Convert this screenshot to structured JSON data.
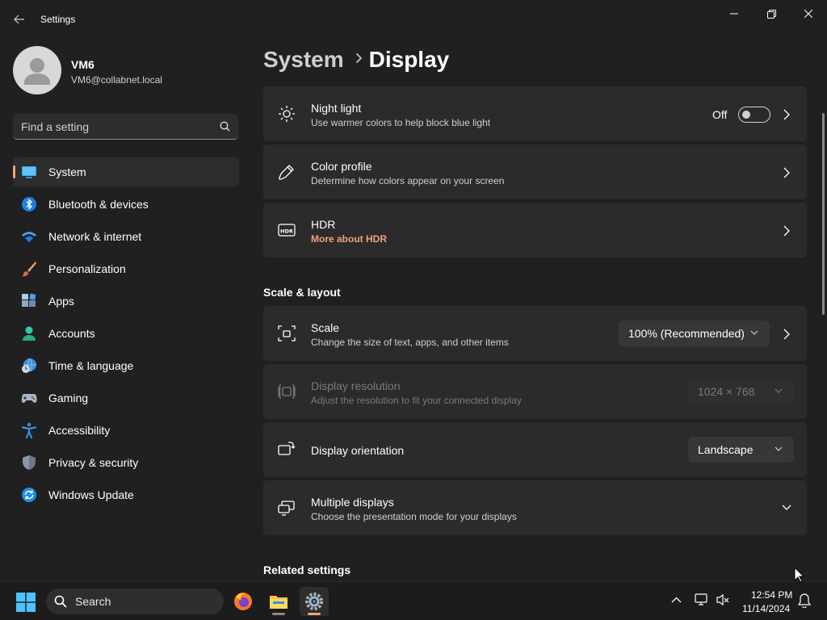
{
  "window": {
    "title": "Settings"
  },
  "user": {
    "name": "VM6",
    "email": "VM6@collabnet.local"
  },
  "search": {
    "placeholder": "Find a setting"
  },
  "sidebar": {
    "items": [
      {
        "label": "System",
        "icon": "system-icon",
        "active": true
      },
      {
        "label": "Bluetooth & devices",
        "icon": "bluetooth-icon"
      },
      {
        "label": "Network & internet",
        "icon": "network-icon"
      },
      {
        "label": "Personalization",
        "icon": "brush-icon"
      },
      {
        "label": "Apps",
        "icon": "apps-icon"
      },
      {
        "label": "Accounts",
        "icon": "accounts-icon"
      },
      {
        "label": "Time & language",
        "icon": "clock-globe-icon"
      },
      {
        "label": "Gaming",
        "icon": "gamepad-icon"
      },
      {
        "label": "Accessibility",
        "icon": "accessibility-icon"
      },
      {
        "label": "Privacy & security",
        "icon": "shield-icon"
      },
      {
        "label": "Windows Update",
        "icon": "update-icon"
      }
    ]
  },
  "breadcrumb": {
    "parent": "System",
    "current": "Display"
  },
  "cards": {
    "night_light": {
      "title": "Night light",
      "subtitle": "Use warmer colors to help block blue light",
      "toggle_label": "Off",
      "toggle_on": false
    },
    "color_profile": {
      "title": "Color profile",
      "subtitle": "Determine how colors appear on your screen"
    },
    "hdr": {
      "title": "HDR",
      "link": "More about HDR"
    }
  },
  "scale_layout": {
    "heading": "Scale & layout",
    "scale": {
      "title": "Scale",
      "subtitle": "Change the size of text, apps, and other items",
      "value": "100% (Recommended)"
    },
    "resolution": {
      "title": "Display resolution",
      "subtitle": "Adjust the resolution to fit your connected display",
      "value": "1024 × 768",
      "disabled": true
    },
    "orientation": {
      "title": "Display orientation",
      "value": "Landscape"
    },
    "multiple": {
      "title": "Multiple displays",
      "subtitle": "Choose the presentation mode for your displays"
    }
  },
  "related": {
    "heading": "Related settings"
  },
  "taskbar": {
    "search_label": "Search",
    "apps": [
      "firefox-icon",
      "file-explorer-icon",
      "settings-icon"
    ],
    "time": "12:54 PM",
    "date": "11/14/2024"
  },
  "colors": {
    "accent": "#f2a07b",
    "background": "#202020",
    "card": "#2b2b2b"
  }
}
